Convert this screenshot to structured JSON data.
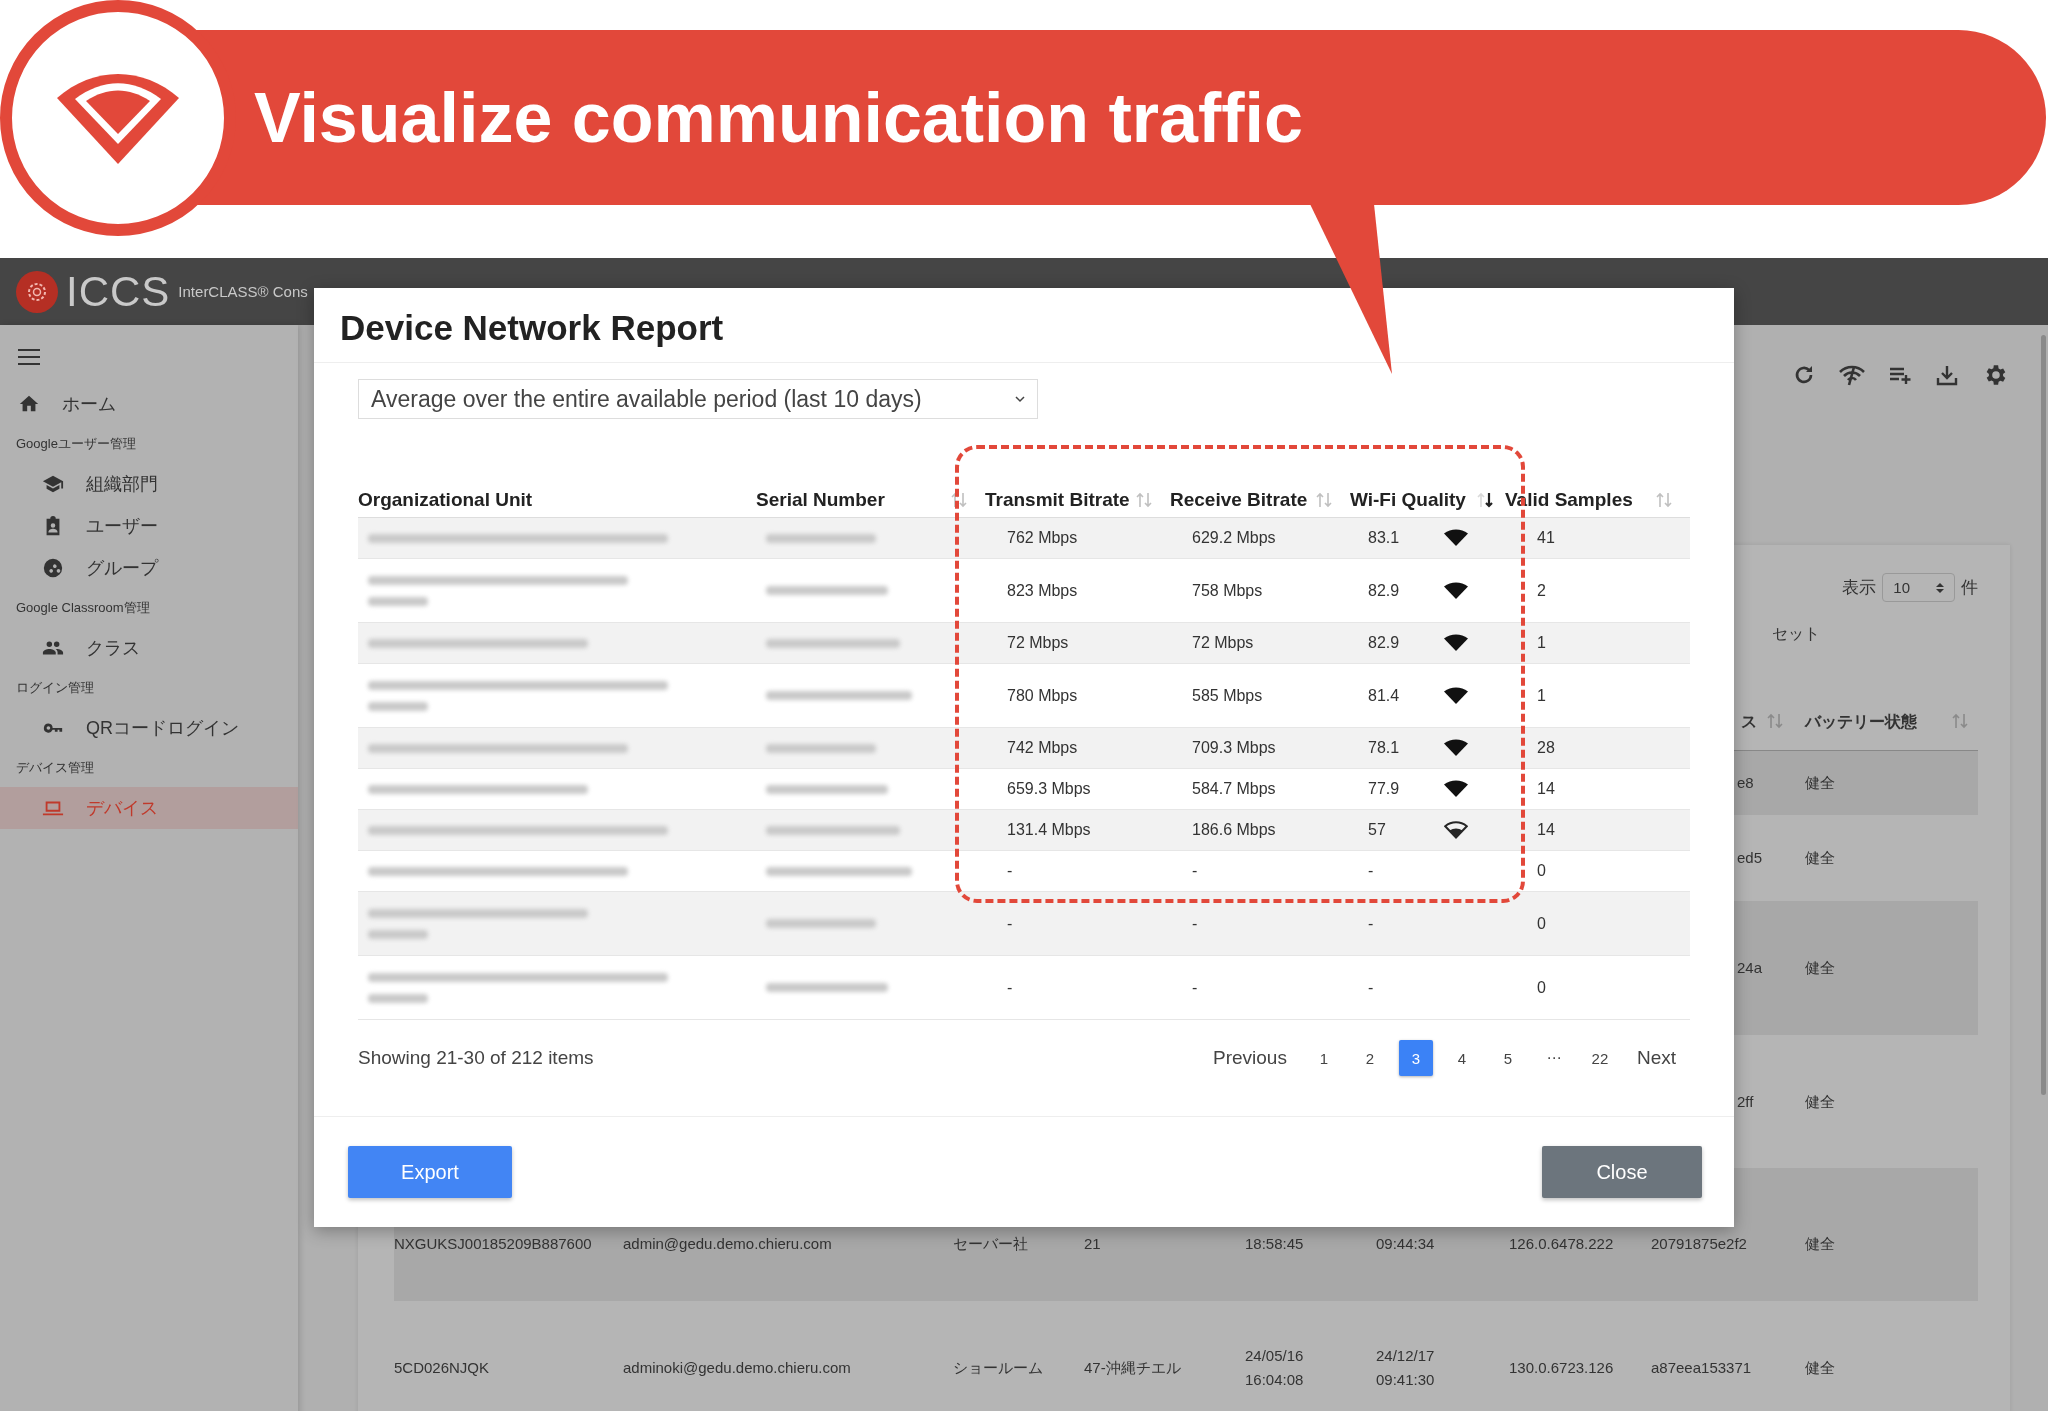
{
  "banner": {
    "title": "Visualize communication traffic"
  },
  "app": {
    "logo": "ICCS",
    "product": "InterCLASS® Cons"
  },
  "sidebar": {
    "items": [
      {
        "kind": "item",
        "label": "ホーム",
        "selected": false
      },
      {
        "kind": "heading",
        "label": "Googleユーザー管理"
      },
      {
        "kind": "item",
        "label": "組織部門",
        "selected": false
      },
      {
        "kind": "item",
        "label": "ユーザー",
        "selected": false
      },
      {
        "kind": "item",
        "label": "グループ",
        "selected": false
      },
      {
        "kind": "heading",
        "label": "Google Classroom管理"
      },
      {
        "kind": "item",
        "label": "クラス",
        "selected": false
      },
      {
        "kind": "heading",
        "label": "ログイン管理"
      },
      {
        "kind": "item",
        "label": "QRコードログイン",
        "selected": false
      },
      {
        "kind": "heading",
        "label": "デバイス管理"
      },
      {
        "kind": "item",
        "label": "デバイス",
        "selected": true
      }
    ]
  },
  "background": {
    "page_size_label": "表示",
    "page_size": "10",
    "page_size_unit": "件",
    "filter_link": "セット",
    "columns": [
      {
        "label": "ス",
        "sortable": true,
        "sorted": false
      },
      {
        "label": "バッテリー状態",
        "sortable": true,
        "sorted": false
      }
    ],
    "rows": [
      {
        "kind": "covered",
        "id": "e8",
        "battery": "健全"
      },
      {
        "kind": "covered",
        "id": "ed5",
        "battery": "健全"
      },
      {
        "kind": "covered",
        "id": "24a",
        "battery": "健全"
      },
      {
        "kind": "covered",
        "id": "2ff",
        "battery": "健全"
      },
      {
        "kind": "low",
        "serial": "NXGUKSJ00185209B887600",
        "email": "admin@gedu.demo.chieru.com",
        "ou": "セーバー社",
        "school": "21",
        "enrolled": "18:58:45",
        "synced": "09:44:34",
        "version": "126.0.6478.222",
        "id": "20791875e2f2",
        "battery": "健全"
      },
      {
        "kind": "full",
        "serial": "5CD026NJQK",
        "email": "adminoki@gedu.demo.chieru.com",
        "ou": "ショールーム",
        "school": "47-沖縄チエル",
        "enrolled": "24/05/16\n16:04:08",
        "synced": "24/12/17\n09:41:30",
        "version": "130.0.6723.126",
        "id": "a87eea153371",
        "battery": "健全"
      }
    ]
  },
  "modal": {
    "title": "Device Network Report",
    "period_select": {
      "value": "Average over the entire available period (last 10 days)"
    },
    "columns": [
      {
        "label": "Organizational Unit",
        "sortable": false
      },
      {
        "label": "Serial Number",
        "sortable": true,
        "sorted": false
      },
      {
        "label": "Transmit Bitrate",
        "sortable": true,
        "sorted": false
      },
      {
        "label": "Receive Bitrate",
        "sortable": true,
        "sorted": false
      },
      {
        "label": "Wi-Fi Quality",
        "sortable": true,
        "sorted": true
      },
      {
        "label": "Valid Samples",
        "sortable": true,
        "sorted": false
      }
    ],
    "rows": [
      {
        "kind": "single",
        "transmit": "762 Mbps",
        "receive": "629.2 Mbps",
        "wifi_quality": "83.1",
        "measured": true,
        "weak": false,
        "valid_samples": "41"
      },
      {
        "kind": "double",
        "transmit": "823 Mbps",
        "receive": "758 Mbps",
        "wifi_quality": "82.9",
        "measured": true,
        "weak": false,
        "valid_samples": "2"
      },
      {
        "kind": "single",
        "transmit": "72 Mbps",
        "receive": "72 Mbps",
        "wifi_quality": "82.9",
        "measured": true,
        "weak": false,
        "valid_samples": "1"
      },
      {
        "kind": "double",
        "transmit": "780 Mbps",
        "receive": "585 Mbps",
        "wifi_quality": "81.4",
        "measured": true,
        "weak": false,
        "valid_samples": "1"
      },
      {
        "kind": "single",
        "transmit": "742 Mbps",
        "receive": "709.3 Mbps",
        "wifi_quality": "78.1",
        "measured": true,
        "weak": false,
        "valid_samples": "28"
      },
      {
        "kind": "single",
        "transmit": "659.3 Mbps",
        "receive": "584.7 Mbps",
        "wifi_quality": "77.9",
        "measured": true,
        "weak": false,
        "valid_samples": "14"
      },
      {
        "kind": "single",
        "transmit": "131.4 Mbps",
        "receive": "186.6 Mbps",
        "wifi_quality": "57",
        "measured": true,
        "weak": true,
        "valid_samples": "14"
      },
      {
        "kind": "single",
        "transmit": "-",
        "receive": "-",
        "wifi_quality": "-",
        "measured": false,
        "valid_samples": "0"
      },
      {
        "kind": "double",
        "transmit": "-",
        "receive": "-",
        "wifi_quality": "-",
        "measured": false,
        "valid_samples": "0"
      },
      {
        "kind": "double",
        "transmit": "-",
        "receive": "-",
        "wifi_quality": "-",
        "measured": false,
        "valid_samples": "0"
      }
    ],
    "summary": "Showing 21-30 of 212 items",
    "pagination": {
      "previous": "Previous",
      "next": "Next",
      "pages": [
        {
          "label": "1",
          "selected": false
        },
        {
          "label": "2",
          "selected": false
        },
        {
          "label": "3",
          "selected": true
        },
        {
          "label": "4",
          "selected": false
        },
        {
          "label": "5",
          "selected": false
        },
        {
          "label": "⋯",
          "selected": false
        },
        {
          "label": "22",
          "selected": false
        }
      ]
    },
    "buttons": {
      "export": "Export",
      "close": "Close"
    }
  }
}
